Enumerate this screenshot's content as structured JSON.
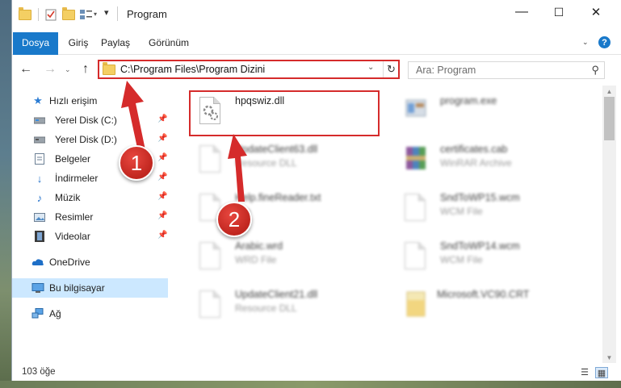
{
  "window": {
    "title": "Program",
    "controls": {
      "minimize": "—",
      "maximize": "☐",
      "close": "✕"
    }
  },
  "ribbon": {
    "tabs": [
      {
        "label": "Dosya"
      },
      {
        "label": "Giriş"
      },
      {
        "label": "Paylaş"
      },
      {
        "label": "Görünüm"
      }
    ],
    "help_label": "?"
  },
  "nav": {
    "address": "C:\\Program Files\\Program Dizini",
    "search_placeholder": "Ara: Program"
  },
  "sidebar": {
    "quick_access": "Hızlı erişim",
    "items": [
      {
        "label": "Yerel Disk (C:)",
        "icon": "drive-icon"
      },
      {
        "label": "Yerel Disk (D:)",
        "icon": "drive-icon"
      },
      {
        "label": "Belgeler",
        "icon": "documents-icon"
      },
      {
        "label": "İndirmeler",
        "icon": "downloads-icon"
      },
      {
        "label": "Müzik",
        "icon": "music-icon"
      },
      {
        "label": "Resimler",
        "icon": "pictures-icon"
      },
      {
        "label": "Videolar",
        "icon": "videos-icon"
      }
    ],
    "onedrive": "OneDrive",
    "this_pc": "Bu bilgisayar",
    "network": "Ağ"
  },
  "files": [
    {
      "name": "hpqswiz.dll",
      "type": ""
    },
    {
      "name": "program.exe",
      "type": ""
    },
    {
      "name": "UpdateClient63.dll",
      "type": "Resource DLL"
    },
    {
      "name": "certificates.cab",
      "type": "WinRAR Archive"
    },
    {
      "name": "Help.fineReader.txt",
      "type": "File"
    },
    {
      "name": "SndToWP15.wcm",
      "type": "WCM File"
    },
    {
      "name": "Arabic.wrd",
      "type": "WRD File"
    },
    {
      "name": "SndToWP14.wcm",
      "type": "WCM File"
    },
    {
      "name": "UpdateClient21.dll",
      "type": "Resource DLL"
    },
    {
      "name": "Microsoft.VC90.CRT",
      "type": ""
    }
  ],
  "status": {
    "item_count": "103 öğe"
  },
  "markers": [
    "1",
    "2"
  ],
  "colors": {
    "accent": "#1979ca",
    "highlight": "#d52b2b",
    "selected": "#cce8ff"
  }
}
